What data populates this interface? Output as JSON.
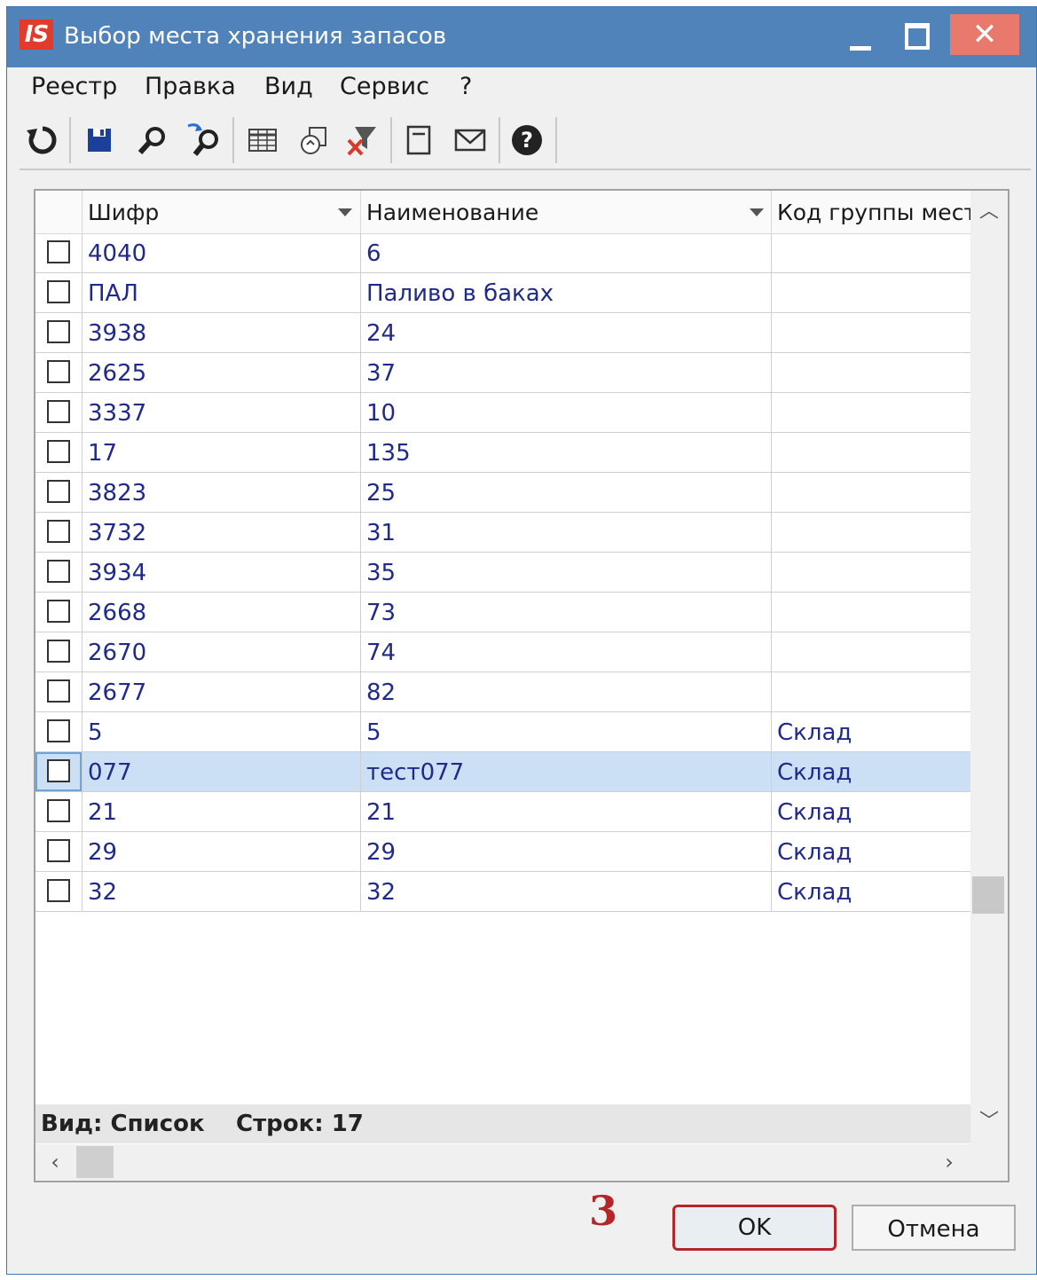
{
  "window": {
    "app_logo": "IS",
    "title": "Выбор места хранения запасов",
    "close_glyph": "✕"
  },
  "menu": {
    "items": [
      "Реестр",
      "Правка",
      "Вид",
      "Сервис",
      "?"
    ]
  },
  "toolbar": {
    "icons": [
      "refresh-icon",
      "save-icon",
      "search-icon",
      "find-next-icon",
      "table-icon",
      "copy-icon",
      "clear-filter-icon",
      "form-icon",
      "mail-icon",
      "help-icon"
    ]
  },
  "grid": {
    "columns": [
      "Шифр",
      "Наименование",
      "Код группы места"
    ],
    "rows": [
      {
        "code": "4040",
        "name": "6",
        "group": ""
      },
      {
        "code": "ПАЛ",
        "name": "Паливо в баках",
        "group": ""
      },
      {
        "code": "3938",
        "name": "24",
        "group": ""
      },
      {
        "code": "2625",
        "name": "37",
        "group": ""
      },
      {
        "code": "3337",
        "name": "10",
        "group": ""
      },
      {
        "code": "17",
        "name": "135",
        "group": ""
      },
      {
        "code": "3823",
        "name": "25",
        "group": ""
      },
      {
        "code": "3732",
        "name": "31",
        "group": ""
      },
      {
        "code": "3934",
        "name": "35",
        "group": ""
      },
      {
        "code": "2668",
        "name": "73",
        "group": ""
      },
      {
        "code": "2670",
        "name": "74",
        "group": ""
      },
      {
        "code": "2677",
        "name": "82",
        "group": ""
      },
      {
        "code": "5",
        "name": "5",
        "group": "Склад"
      },
      {
        "code": "077",
        "name": "тест077",
        "group": "Склад",
        "selected": true
      },
      {
        "code": "21",
        "name": "21",
        "group": "Склад"
      },
      {
        "code": "29",
        "name": "29",
        "group": "Склад"
      },
      {
        "code": "32",
        "name": "32",
        "group": "Склад"
      }
    ],
    "status_view": "Вид: Список",
    "status_rows": "Строк: 17"
  },
  "annotation": "3",
  "buttons": {
    "ok": "OK",
    "cancel": "Отмена"
  },
  "colors": {
    "titlebar": "#4f83b9",
    "selected_row": "#cce0f5",
    "cell_text": "#1f2a8a",
    "highlight_red": "#b3262a"
  }
}
